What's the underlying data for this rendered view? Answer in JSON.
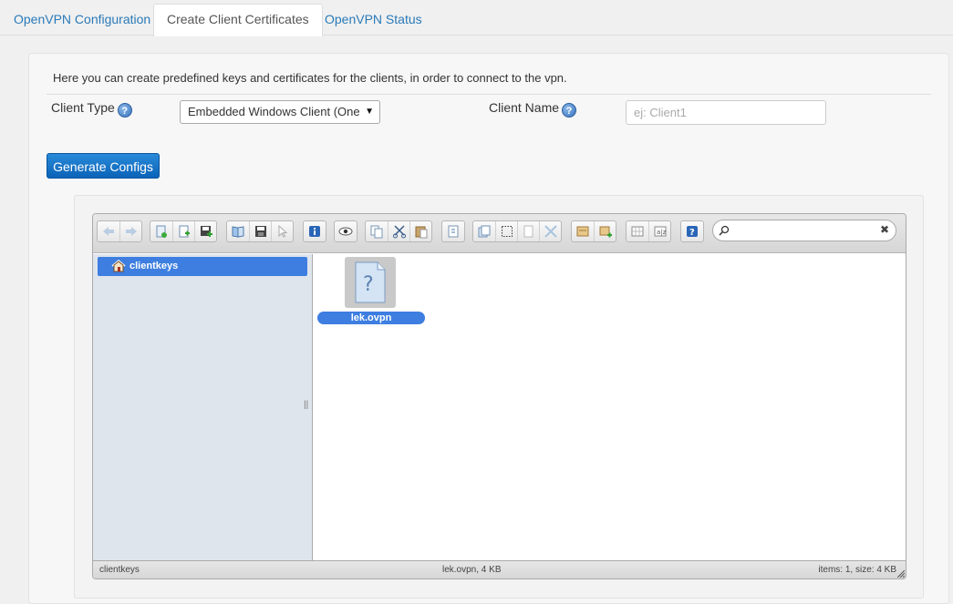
{
  "tabs": [
    {
      "label": "OpenVPN Configuration"
    },
    {
      "label": "Create Client Certificates"
    },
    {
      "label": "OpenVPN Status"
    }
  ],
  "form": {
    "intro": "Here you can create predefined keys and certificates for the clients, in order to connect to the vpn.",
    "client_type_label": "Client Type",
    "client_type_value": "Embedded Windows Client (One",
    "client_name_label": "Client Name",
    "client_name_placeholder": "ej: Client1",
    "client_name_value": "",
    "generate_label": "Generate Configs"
  },
  "filemanager": {
    "tree": [
      {
        "label": "clientkeys"
      }
    ],
    "files": [
      {
        "name": "lek.ovpn"
      }
    ],
    "search_value": "",
    "status": {
      "path": "clientkeys",
      "selection": "lek.ovpn, 4 KB",
      "summary": "items: 1, size: 4 KB"
    }
  },
  "colors": {
    "accent": "#2a7ab8",
    "primary_button": "#0a63b8",
    "selection": "#3d7ee0",
    "tree_bg": "#dfe5ec"
  }
}
